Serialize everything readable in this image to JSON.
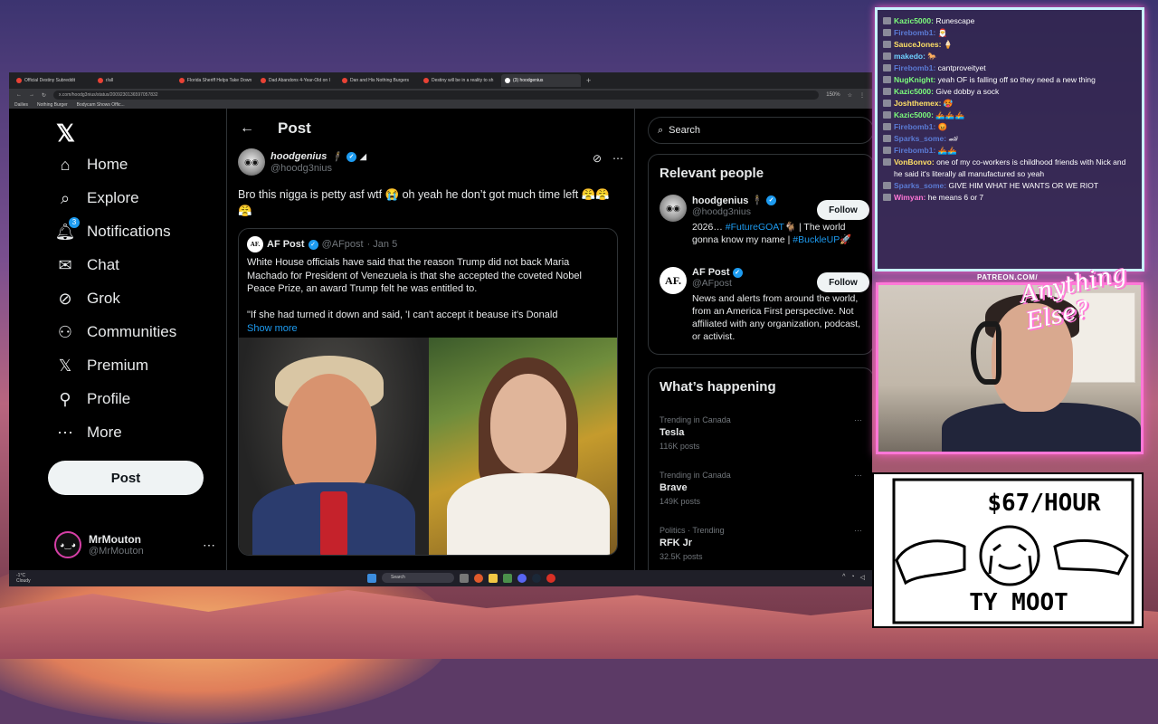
{
  "browser": {
    "tabs": [
      {
        "label": "Official Destiny Subreddit"
      },
      {
        "label": "r/all"
      },
      {
        "label": "Florida Sheriff Helps Take Down"
      },
      {
        "label": "Dad Abandons 4-Year-Old on I"
      },
      {
        "label": "Dan and His Nothing Burgers"
      },
      {
        "label": "Destiny will be in a reality to sh"
      },
      {
        "label": "(3) hoodgenius"
      }
    ],
    "url": "x.com/hoodg3nius/status/2009230136597057832",
    "zoom": "150%",
    "bookmarks": [
      "Dailies",
      "Nothing Burger",
      "Bodycam Shows Offic..."
    ]
  },
  "nav": {
    "items": [
      {
        "label": "Home",
        "icon": "home-icon"
      },
      {
        "label": "Explore",
        "icon": "search-icon"
      },
      {
        "label": "Notifications",
        "icon": "bell-icon",
        "badge": "3"
      },
      {
        "label": "Chat",
        "icon": "mail-icon"
      },
      {
        "label": "Grok",
        "icon": "grok-icon"
      },
      {
        "label": "Communities",
        "icon": "people-icon"
      },
      {
        "label": "Premium",
        "icon": "x-icon"
      },
      {
        "label": "Profile",
        "icon": "person-icon"
      },
      {
        "label": "More",
        "icon": "more-icon"
      }
    ],
    "post_label": "Post",
    "account": {
      "name": "MrMouton",
      "handle": "@MrMouton"
    }
  },
  "main": {
    "header_title": "Post",
    "author": {
      "name": "hoodgenius",
      "emoji": "🕴",
      "handle": "@hoodg3nius"
    },
    "text": "Bro this nigga is petty asf wtf 😭 oh yeah he don’t got much time left 😤😤😤",
    "quote": {
      "name": "AF Post",
      "handle": "@AFpost",
      "date": "· Jan 5",
      "avatar_text": "AF.",
      "text": "White House officials have said that the reason Trump did not back Maria Machado for President of Venezuela is that she accepted the coveted Nobel Peace Prize, an award Trump felt he was entitled to.\n\n\"If she had turned it down and said, 'I can't accept it beause it's Donald",
      "show_more": "Show more"
    }
  },
  "rail": {
    "search_placeholder": "Search",
    "relevant_title": "Relevant people",
    "people": [
      {
        "name": "hoodgenius",
        "handle": "@hoodg3nius",
        "bio_pre": "2026… ",
        "bio_tag1": "#FutureGOAT",
        "bio_mid": "🐐 | The world gonna know my name | ",
        "bio_tag2": "#BuckleUP",
        "bio_end": "🚀",
        "follow": "Follow"
      },
      {
        "name": "AF Post",
        "handle": "@AFpost",
        "bio": "News and alerts from around the world, from an America First perspective. Not affiliated with any organization, podcast, or activist.",
        "follow": "Follow",
        "avatar_text": "AF."
      }
    ],
    "happening_title": "What’s happening",
    "trends": [
      {
        "context": "Trending in Canada",
        "name": "Tesla",
        "posts": "116K posts"
      },
      {
        "context": "Trending in Canada",
        "name": "Brave",
        "posts": "149K posts"
      },
      {
        "context": "Politics · Trending",
        "name": "RFK Jr",
        "posts": "32.5K posts"
      }
    ]
  },
  "taskbar": {
    "weather_temp": "-1°C",
    "weather_desc": "Cloudy",
    "search_placeholder": "Search"
  },
  "chat": {
    "messages": [
      {
        "user": "Kazic5000:",
        "text": "Runescape",
        "color": "#7cfc7c"
      },
      {
        "user": "Firebomb1:",
        "text": "🎅",
        "color": "#5b7bd5"
      },
      {
        "user": "SauceJones:",
        "text": "🍦",
        "color": "#ffe066"
      },
      {
        "user": "makedo:",
        "text": "🐎",
        "color": "#6fd0ff"
      },
      {
        "user": "Firebomb1:",
        "text": "cantproveityet",
        "color": "#5b7bd5"
      },
      {
        "user": "NugKnight:",
        "text": "yeah OF is falling off so they need a new thing",
        "color": "#7cfc7c"
      },
      {
        "user": "Kazic5000:",
        "text": "Give dobby a sock",
        "color": "#7cfc7c"
      },
      {
        "user": "Joshthemex:",
        "text": "🥵",
        "color": "#ffe066"
      },
      {
        "user": "Kazic5000:",
        "text": "🚣🏽🚣🏽🚣🏽",
        "color": "#7cfc7c"
      },
      {
        "user": "Firebomb1:",
        "text": "😡",
        "color": "#5b7bd5"
      },
      {
        "user": "Sparks_some:",
        "text": "🏎",
        "color": "#5b7bd5"
      },
      {
        "user": "Firebomb1:",
        "text": "🚣🏽🚣🏽",
        "color": "#5b7bd5"
      },
      {
        "user": "VonBonvo:",
        "text": "one of my co-workers is childhood friends with Nick and he said it's literally all manufactured so yeah",
        "color": "#ffe066"
      },
      {
        "user": "Sparks_some:",
        "text": "GIVE HIM WHAT HE WANTS OR WE RIOT",
        "color": "#5b7bd5"
      },
      {
        "user": "Wimyan:",
        "text": "he means 6 or 7",
        "color": "#ff77d7"
      }
    ]
  },
  "overlay": {
    "patreon": "PATREON.COM/",
    "logo_text": "Anything Else?",
    "sign_top": "$67/HOUR",
    "sign_bottom": "TY MOOT"
  }
}
